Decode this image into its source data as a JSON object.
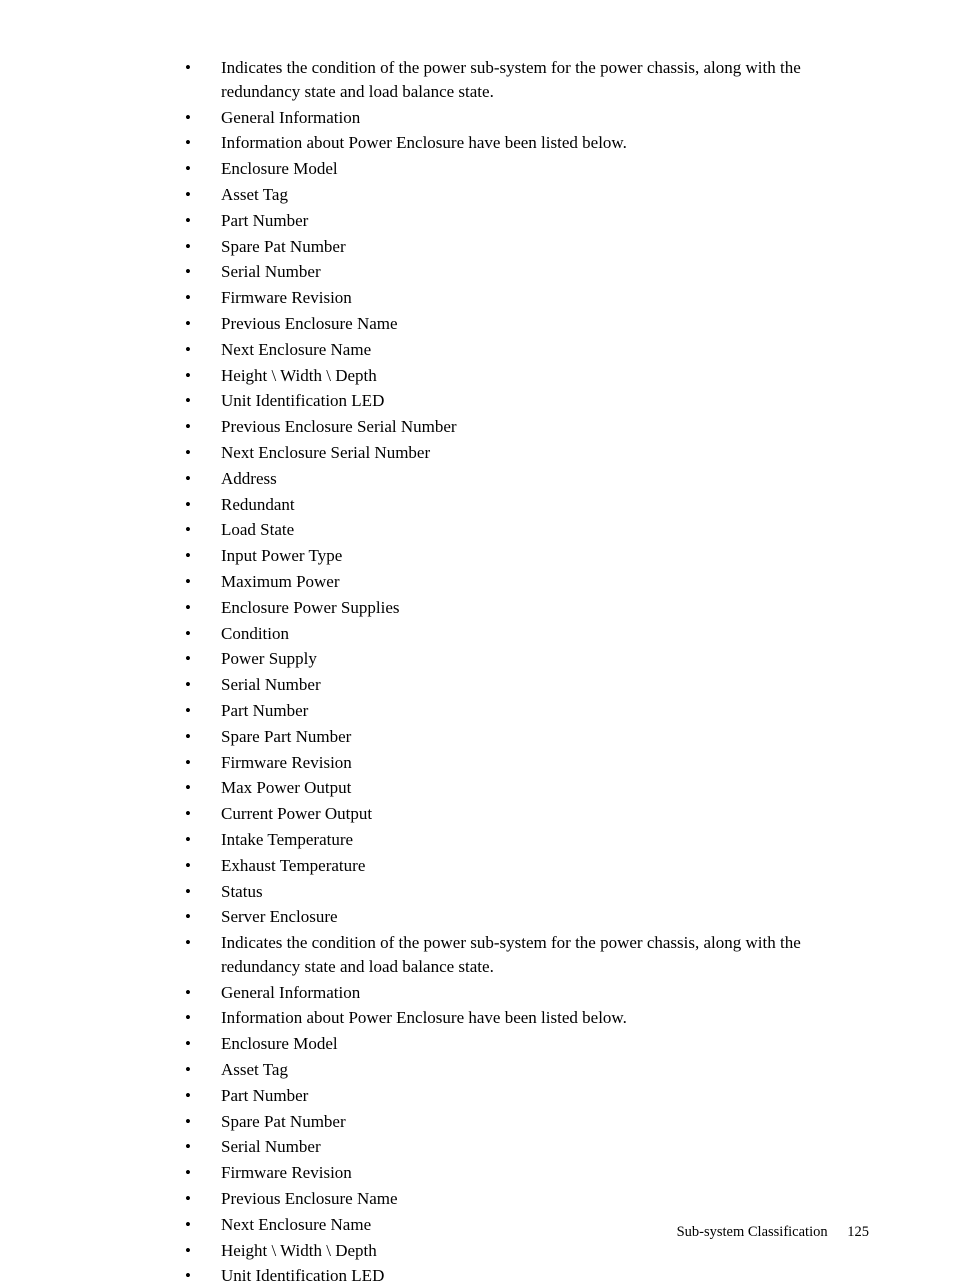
{
  "listItems": [
    "Indicates the condition of the power sub-system for the power chassis, along with the redundancy state and load balance state.",
    "General Information",
    "Information about Power Enclosure have been listed below.",
    "Enclosure Model",
    "Asset Tag",
    "Part Number",
    "Spare Pat Number",
    "Serial Number",
    "Firmware Revision",
    "Previous Enclosure Name",
    "Next Enclosure Name",
    "Height \\ Width \\ Depth",
    "Unit Identification LED",
    "Previous Enclosure Serial Number",
    "Next Enclosure Serial Number",
    "Address",
    "Redundant",
    "Load State",
    "Input Power Type",
    "Maximum Power",
    "Enclosure Power Supplies",
    "Condition",
    "Power Supply",
    "Serial Number",
    "Part Number",
    "Spare Part Number",
    "Firmware Revision",
    "Max Power Output",
    "Current Power Output",
    "Intake Temperature",
    "Exhaust Temperature",
    "Status",
    "Server Enclosure",
    "Indicates the condition of the power sub-system for the power chassis, along with the redundancy state and load balance state.",
    "General Information",
    "Information about Power Enclosure have been listed below.",
    "Enclosure Model",
    "Asset Tag",
    "Part Number",
    "Spare Pat Number",
    "Serial Number",
    "Firmware Revision",
    "Previous Enclosure Name",
    "Next Enclosure Name",
    "Height \\ Width \\ Depth",
    "Unit Identification LED"
  ],
  "footer": {
    "sectionTitle": "Sub-system Classification",
    "pageNumber": "125"
  }
}
